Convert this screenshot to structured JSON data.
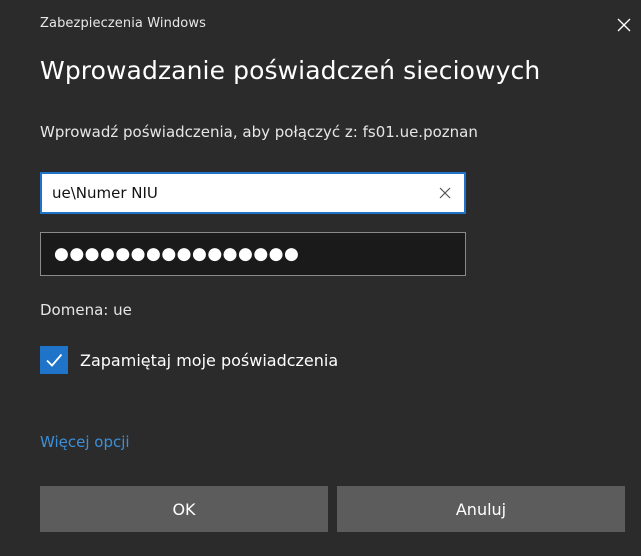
{
  "window": {
    "app_title": "Zabezpieczenia Windows",
    "close_icon": "close-icon"
  },
  "dialog": {
    "heading": "Wprowadzanie poświadczeń sieciowych",
    "prompt": "Wprowadź poświadczenia, aby połączyć z: fs01.ue.poznan",
    "username": {
      "value": "ue\\Numer NIU",
      "clear_icon": "clear-icon"
    },
    "password": {
      "masked_value": "●●●●●●●●●●●●●●●●"
    },
    "domain_text": "Domena: ue",
    "remember": {
      "label": "Zapamiętaj moje poświadczenia",
      "checked": true
    },
    "more_options_link": "Więcej opcji",
    "buttons": {
      "ok_label": "OK",
      "cancel_label": "Anuluj"
    }
  },
  "colors": {
    "background": "#2b2b2b",
    "accent": "#1f74c9",
    "link": "#3b8fdb",
    "button": "#5c5c5c",
    "password_field": "#1a1a1a"
  }
}
